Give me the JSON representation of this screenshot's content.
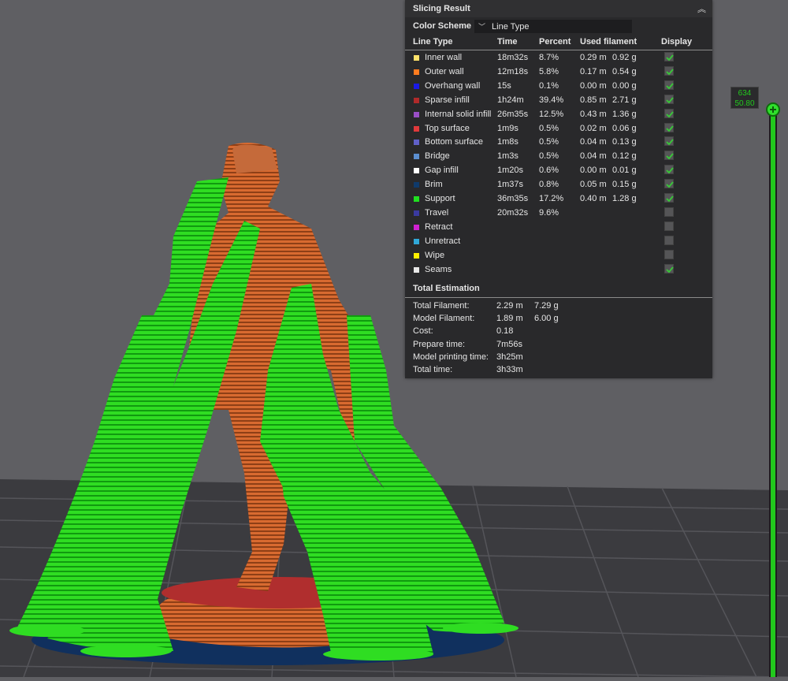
{
  "panel": {
    "title": "Slicing Result",
    "color_scheme_label": "Color Scheme",
    "color_scheme_value": "Line Type",
    "headers": {
      "line_type": "Line Type",
      "time": "Time",
      "percent": "Percent",
      "used": "Used filament",
      "display": "Display"
    },
    "rows": [
      {
        "name": "Inner wall",
        "color": "#ffe26b",
        "time": "18m32s",
        "percent": "8.7%",
        "meters": "0.29 m",
        "grams": "0.92 g",
        "display": true
      },
      {
        "name": "Outer wall",
        "color": "#ff7c1f",
        "time": "12m18s",
        "percent": "5.8%",
        "meters": "0.17 m",
        "grams": "0.54 g",
        "display": true
      },
      {
        "name": "Overhang wall",
        "color": "#1a1ae6",
        "time": "15s",
        "percent": "0.1%",
        "meters": "0.00 m",
        "grams": "0.00 g",
        "display": true
      },
      {
        "name": "Sparse infill",
        "color": "#b02a2a",
        "time": "1h24m",
        "percent": "39.4%",
        "meters": "0.85 m",
        "grams": "2.71 g",
        "display": true
      },
      {
        "name": "Internal solid infill",
        "color": "#9a4fc7",
        "time": "26m35s",
        "percent": "12.5%",
        "meters": "0.43 m",
        "grams": "1.36 g",
        "display": true
      },
      {
        "name": "Top surface",
        "color": "#e0393b",
        "time": "1m9s",
        "percent": "0.5%",
        "meters": "0.02 m",
        "grams": "0.06 g",
        "display": true
      },
      {
        "name": "Bottom surface",
        "color": "#6060c8",
        "time": "1m8s",
        "percent": "0.5%",
        "meters": "0.04 m",
        "grams": "0.13 g",
        "display": true
      },
      {
        "name": "Bridge",
        "color": "#5b8ed0",
        "time": "1m3s",
        "percent": "0.5%",
        "meters": "0.04 m",
        "grams": "0.12 g",
        "display": true
      },
      {
        "name": "Gap infill",
        "color": "#ffffff",
        "time": "1m20s",
        "percent": "0.6%",
        "meters": "0.00 m",
        "grams": "0.01 g",
        "display": true
      },
      {
        "name": "Brim",
        "color": "#0f3a6b",
        "time": "1m37s",
        "percent": "0.8%",
        "meters": "0.05 m",
        "grams": "0.15 g",
        "display": true
      },
      {
        "name": "Support",
        "color": "#20e020",
        "time": "36m35s",
        "percent": "17.2%",
        "meters": "0.40 m",
        "grams": "1.28 g",
        "display": true
      },
      {
        "name": "Travel",
        "color": "#3a3aa0",
        "time": "20m32s",
        "percent": "9.6%",
        "meters": "",
        "grams": "",
        "display": false
      },
      {
        "name": "Retract",
        "color": "#d020d0",
        "time": "",
        "percent": "",
        "meters": "",
        "grams": "",
        "display": false
      },
      {
        "name": "Unretract",
        "color": "#30a8d8",
        "time": "",
        "percent": "",
        "meters": "",
        "grams": "",
        "display": false
      },
      {
        "name": "Wipe",
        "color": "#ffee00",
        "time": "",
        "percent": "",
        "meters": "",
        "grams": "",
        "display": false
      },
      {
        "name": "Seams",
        "color": "#e8e8e8",
        "time": "",
        "percent": "",
        "meters": "",
        "grams": "",
        "display": true
      }
    ],
    "total_title": "Total Estimation",
    "totals": [
      {
        "label": "Total Filament:",
        "v1": "2.29 m",
        "v2": "7.29 g"
      },
      {
        "label": "Model Filament:",
        "v1": "1.89 m",
        "v2": "6.00 g"
      },
      {
        "label": "Cost:",
        "v1": "0.18",
        "v2": ""
      },
      {
        "label": "Prepare time:",
        "v1": "7m56s",
        "v2": ""
      },
      {
        "label": "Model printing time:",
        "v1": "3h25m",
        "v2": ""
      },
      {
        "label": "Total time:",
        "v1": "3h33m",
        "v2": ""
      }
    ]
  },
  "slider": {
    "layer": "634",
    "height": "50.80"
  },
  "colors": {
    "support": "#22c91d",
    "model": "#c8612b",
    "base": "#b23030",
    "brim": "#102a5a",
    "bed": "#3a3a3e"
  }
}
